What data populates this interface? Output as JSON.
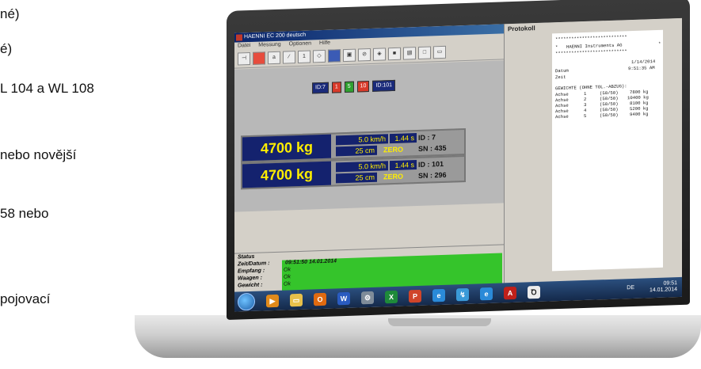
{
  "document": {
    "lines": [
      "né)",
      "é)",
      "L 104 a WL 108",
      "nebo novější",
      "58 nebo",
      "pojovací"
    ]
  },
  "app": {
    "title": "HAENNI EC 200 deutsch",
    "menu": [
      "Datei",
      "Messung",
      "Optionen",
      "Hilfe"
    ],
    "toolbar_icons": [
      "scale-icon",
      "truck-icon",
      "abc-icon",
      "ruler-icon",
      "number-one-icon",
      "weight-icon",
      "camera-icon",
      "vehicle-icon",
      "cancel-icon",
      "print-icon",
      "save-icon",
      "disk-icon",
      "window-icon",
      "page-icon"
    ],
    "chips": {
      "id1": "ID:7",
      "c1": "1",
      "c2": "5",
      "c3": "10",
      "id2": "ID:101"
    },
    "scales": [
      {
        "weight": "4700 kg",
        "speed": "5.0 km/h",
        "time": "1.44 s",
        "id": "ID : 7",
        "distance": "25 cm",
        "zero": "ZERO",
        "sn": "SN : 435"
      },
      {
        "weight": "4700 kg",
        "speed": "5.0 km/h",
        "time": "1.44 s",
        "id": "ID : 101",
        "distance": "25 cm",
        "zero": "ZERO",
        "sn": "SN : 296"
      }
    ],
    "status": {
      "title": "Status",
      "datetime_label": "Zeit/Datum :",
      "datetime_value": "09:51:50  14.01.2014",
      "empfang_label": "Empfang :",
      "empfang_value": "Ok",
      "waagen_label": "Waagen :",
      "waagen_value": "Ok",
      "gewicht_label": "Gewicht :",
      "gewicht_value": "Ok"
    }
  },
  "protocol": {
    "title": "Protokoll",
    "company": "HAENNI Instruments AG",
    "datum_label": "Datum",
    "datum_value": "1/14/2014",
    "zeit_label": "Zeit",
    "zeit_value": "9:51:35 AM",
    "header": "GEWICHTE (OHNE TOL.-ABZUG):",
    "rows": [
      {
        "label": "Achse",
        "n": "1",
        "ratio": "(50/50)",
        "value": "7800 kg"
      },
      {
        "label": "Achse",
        "n": "2",
        "ratio": "(50/50)",
        "value": "10400 kg"
      },
      {
        "label": "Achse",
        "n": "3",
        "ratio": "(50/50)",
        "value": "8100 kg"
      },
      {
        "label": "Achse",
        "n": "4",
        "ratio": "(50/50)",
        "value": "5200 kg"
      },
      {
        "label": "Achse",
        "n": "5",
        "ratio": "(50/50)",
        "value": "9400 kg"
      }
    ]
  },
  "taskbar": {
    "lang": "DE",
    "time": "09:51",
    "date": "14.01.2014",
    "apps": [
      "media-player-icon",
      "explorer-icon",
      "outlook-icon",
      "word-icon",
      "utility-icon",
      "excel-icon",
      "powerpoint-icon",
      "ie-icon",
      "network-icon",
      "ie-icon",
      "pdf-icon",
      "haenni-icon"
    ]
  },
  "colors": {
    "display_bg": "#14226e",
    "display_text": "#ffee00",
    "status_ok": "#35c42b",
    "titlebar": "#0a246a"
  }
}
